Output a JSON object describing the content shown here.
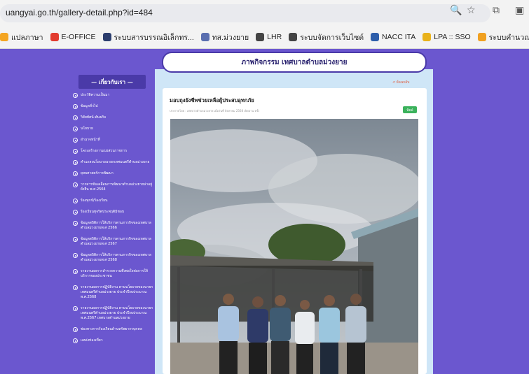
{
  "browser": {
    "url": "uangyai.go.th/gallery-detail.php?id=484",
    "bookmarks": [
      {
        "label": "แปลภาษา",
        "color": "#f4a522"
      },
      {
        "label": "E-OFFICE",
        "color": "#e23b2e"
      },
      {
        "label": "ระบบสารบรรณอิเล็กทร...",
        "color": "#2c3e6e"
      },
      {
        "label": "ทส.ม่วงยาย",
        "color": "#5a6fb0"
      },
      {
        "label": "LHR",
        "color": "#444444"
      },
      {
        "label": "ระบบจัดการเว็บไซต์",
        "color": "#444444"
      },
      {
        "label": "NACC ITA",
        "color": "#2e5eaa"
      },
      {
        "label": "LPA :: SSO",
        "color": "#e9b21a"
      },
      {
        "label": "ระบบคำนวณยอดขยการ...",
        "color": "#f0a020"
      }
    ]
  },
  "sidebar": {
    "title": "— เกี่ยวกับเรา —",
    "items": [
      "ประวัติความเป็นมา",
      "ข้อมูลทั่วไป",
      "วิสัยทัศน์-พันธกิจ",
      "นโยบาย",
      "อำนาจหน้าที่",
      "โครงสร้างการแบ่งส่วนราชการ",
      "คำแถลงนโยบายนายกเทศมนตรีตำบลม่วงยาย",
      "ยุทธศาสตร์การพัฒนา",
      "วารสารขับเคลื่อนการพัฒนาตำบลม่วงยายน่าอยู่ยั่งยืน พ.ศ.2564",
      "ร้องทุกข์/ร้องเรียน",
      "ร้องเรียนทุจริตประพฤติมิชอบ",
      "ข้อมูลสถิติการให้บริการตามภารกิจของเทศบาลตำบลม่วงยายพ.ศ 2566",
      "ข้อมูลสถิติการให้บริการตามภารกิจของเทศบาลตำบลม่วงยายพ.ศ 2567",
      "ข้อมูลสถิติการให้บริการตามภารกิจของเทศบาลตำบลม่วงยายพ.ศ 2568",
      "รายงานผลการสำรวจความพึงพอใจต่อการให้บริการของประชาชน",
      "รายงานผลการปฏิบัติงาน ตามนโยบายของนายกเทศมนตรีตำบลม่วงยาย ประจำปีงบประมาณ พ.ศ.2568",
      "รายงานผลการปฏิบัติงาน ตามนโยบายของนายกเทศมนตรีตำบลม่วงยาย ประจำปีงบประมาณ พ.ศ.2567 เทศบาลตำบลม่วงยาย",
      "ช่องทางการร้องเรียนด้านทรัพยากรบุคคล",
      "แหล่งท่องเที่ยว"
    ]
  },
  "banner": {
    "title": "ภาพกิจกรรม เทศบาลตำบลม่วงยาย"
  },
  "back_link": "< ย้อนกลับ",
  "article": {
    "title": "มอบถุงยังชีพช่วยเหลือผู้ประสบอุทกภัย",
    "meta": "ประกาศโดย : เทศบาลตำบลม่วงยาย เมื่อวันที่ สิงหาคม 2568 เปิดอ่าน ครั้ง",
    "print_label": "พิมพ์"
  },
  "colors": {
    "accent": "#6b57cf",
    "sidebar_header": "#4a3aa8",
    "print_button": "#3bb25c"
  }
}
